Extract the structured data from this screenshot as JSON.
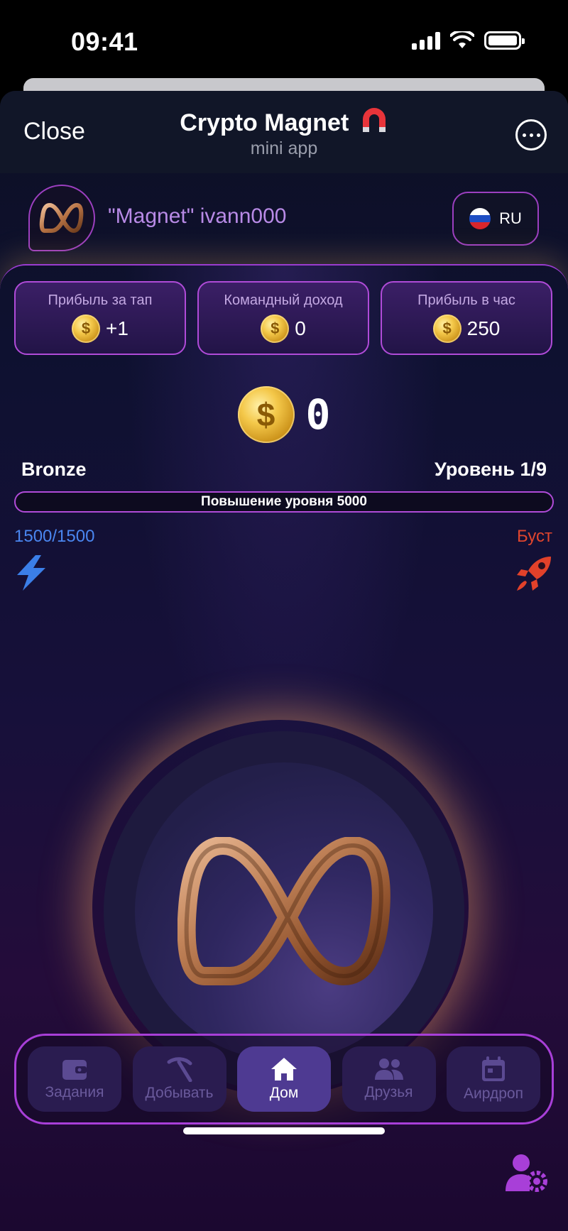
{
  "status_bar": {
    "time": "09:41"
  },
  "header": {
    "close_label": "Close",
    "title": "Crypto Magnet",
    "subtitle": "mini app"
  },
  "user": {
    "name": "\"Magnet\" ivann000",
    "language": "RU"
  },
  "stats": [
    {
      "label": "Прибыль за тап",
      "value": "+1"
    },
    {
      "label": "Командный доход",
      "value": "0"
    },
    {
      "label": "Прибыль в час",
      "value": "250"
    }
  ],
  "balance": "0",
  "league": "Bronze",
  "level": "Уровень 1/9",
  "level_bar_text": "Повышение уровня 5000",
  "energy": "1500/1500",
  "boost_label": "Буст",
  "nav": [
    {
      "label": "Задания",
      "icon": "wallet-icon",
      "active": false
    },
    {
      "label": "Добывать",
      "icon": "pickaxe-icon",
      "active": false
    },
    {
      "label": "Дом",
      "icon": "home-icon",
      "active": true
    },
    {
      "label": "Друзья",
      "icon": "friends-icon",
      "active": false
    },
    {
      "label": "Аирдроп",
      "icon": "calendar-icon",
      "active": false
    }
  ],
  "colors": {
    "accent_purple": "#a83fd8",
    "energy_blue": "#4a86f0",
    "boost_red": "#e0452e",
    "username_purple": "#b88ae6"
  }
}
